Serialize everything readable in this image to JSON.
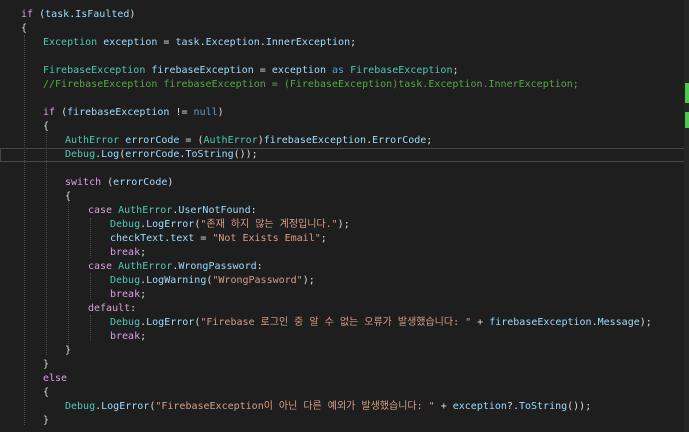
{
  "colors": {
    "background": "#1e1e1e",
    "keyword": "#569cd6",
    "control": "#d8a0df",
    "type": "#4ec9b0",
    "identifier": "#9cdcfe",
    "string": "#d69d85",
    "comment": "#57a64a",
    "text": "#dcdcdc",
    "minimap_green": "#4ec94e",
    "minimap_yellow": "#d7ba7d"
  },
  "code": {
    "l1": [
      [
        "ctl",
        "if"
      ],
      [
        "op",
        " ("
      ],
      [
        "id",
        "task"
      ],
      [
        "op",
        "."
      ],
      [
        "id",
        "IsFaulted"
      ],
      [
        "op",
        ")"
      ]
    ],
    "l2": [
      [
        "op",
        "{"
      ]
    ],
    "l3": [
      [
        "type",
        "Exception"
      ],
      [
        "op",
        " "
      ],
      [
        "id",
        "exception"
      ],
      [
        "op",
        " = "
      ],
      [
        "id",
        "task"
      ],
      [
        "op",
        "."
      ],
      [
        "id",
        "Exception"
      ],
      [
        "op",
        "."
      ],
      [
        "id",
        "InnerException"
      ],
      [
        "op",
        ";"
      ]
    ],
    "l4": [],
    "l5": [
      [
        "type",
        "FirebaseException"
      ],
      [
        "op",
        " "
      ],
      [
        "id",
        "firebaseException"
      ],
      [
        "op",
        " = "
      ],
      [
        "id",
        "exception"
      ],
      [
        "op",
        " "
      ],
      [
        "kw",
        "as"
      ],
      [
        "op",
        " "
      ],
      [
        "type",
        "FirebaseException"
      ],
      [
        "op",
        ";"
      ]
    ],
    "l6": [
      [
        "cm",
        "//FirebaseException firebaseException = (FirebaseException)task.Exception.InnerException;"
      ]
    ],
    "l7": [],
    "l8": [
      [
        "ctl",
        "if"
      ],
      [
        "op",
        " ("
      ],
      [
        "id",
        "firebaseException"
      ],
      [
        "op",
        " != "
      ],
      [
        "kw",
        "null"
      ],
      [
        "op",
        ")"
      ]
    ],
    "l9": [
      [
        "op",
        "{"
      ]
    ],
    "l10": [
      [
        "type",
        "AuthError"
      ],
      [
        "op",
        " "
      ],
      [
        "id",
        "errorCode"
      ],
      [
        "op",
        " = ("
      ],
      [
        "type",
        "AuthError"
      ],
      [
        "op",
        ")"
      ],
      [
        "id",
        "firebaseException"
      ],
      [
        "op",
        "."
      ],
      [
        "id",
        "ErrorCode"
      ],
      [
        "op",
        ";"
      ]
    ],
    "l11": [
      [
        "type",
        "Debug"
      ],
      [
        "op",
        "."
      ],
      [
        "id",
        "Log"
      ],
      [
        "op",
        "("
      ],
      [
        "id",
        "errorCode"
      ],
      [
        "op",
        "."
      ],
      [
        "id",
        "ToString"
      ],
      [
        "op",
        "());"
      ]
    ],
    "l12": [],
    "l13": [
      [
        "ctl",
        "switch"
      ],
      [
        "op",
        " ("
      ],
      [
        "id",
        "errorCode"
      ],
      [
        "op",
        ")"
      ]
    ],
    "l14": [
      [
        "op",
        "{"
      ]
    ],
    "l15": [
      [
        "ctl",
        "case"
      ],
      [
        "op",
        " "
      ],
      [
        "type",
        "AuthError"
      ],
      [
        "op",
        "."
      ],
      [
        "id",
        "UserNotFound"
      ],
      [
        "op",
        ":"
      ]
    ],
    "l16": [
      [
        "type",
        "Debug"
      ],
      [
        "op",
        "."
      ],
      [
        "id",
        "LogError"
      ],
      [
        "op",
        "("
      ],
      [
        "str",
        "\"존재 하지 않는 계정입니다.\""
      ],
      [
        "op",
        ");"
      ]
    ],
    "l17": [
      [
        "id",
        "checkText"
      ],
      [
        "op",
        "."
      ],
      [
        "id",
        "text"
      ],
      [
        "op",
        " = "
      ],
      [
        "str",
        "\"Not Exists Email\""
      ],
      [
        "op",
        ";"
      ]
    ],
    "l18": [
      [
        "ctl",
        "break"
      ],
      [
        "op",
        ";"
      ]
    ],
    "l19": [
      [
        "ctl",
        "case"
      ],
      [
        "op",
        " "
      ],
      [
        "type",
        "AuthError"
      ],
      [
        "op",
        "."
      ],
      [
        "id",
        "WrongPassword"
      ],
      [
        "op",
        ":"
      ]
    ],
    "l20": [
      [
        "type",
        "Debug"
      ],
      [
        "op",
        "."
      ],
      [
        "id",
        "LogWarning"
      ],
      [
        "op",
        "("
      ],
      [
        "str",
        "\"WrongPassword\""
      ],
      [
        "op",
        ");"
      ]
    ],
    "l21": [
      [
        "ctl",
        "break"
      ],
      [
        "op",
        ";"
      ]
    ],
    "l22": [
      [
        "ctl",
        "default"
      ],
      [
        "op",
        ":"
      ]
    ],
    "l23": [
      [
        "type",
        "Debug"
      ],
      [
        "op",
        "."
      ],
      [
        "id",
        "LogError"
      ],
      [
        "op",
        "("
      ],
      [
        "str",
        "\"Firebase 로그인 중 알 수 없는 오류가 발생했습니다: \""
      ],
      [
        "op",
        " + "
      ],
      [
        "id",
        "firebaseException"
      ],
      [
        "op",
        "."
      ],
      [
        "id",
        "Message"
      ],
      [
        "op",
        ");"
      ]
    ],
    "l24": [
      [
        "ctl",
        "break"
      ],
      [
        "op",
        ";"
      ]
    ],
    "l25": [
      [
        "op",
        "}"
      ]
    ],
    "l26": [
      [
        "op",
        "}"
      ]
    ],
    "l27": [
      [
        "ctl",
        "else"
      ]
    ],
    "l28": [
      [
        "op",
        "{"
      ]
    ],
    "l29": [
      [
        "type",
        "Debug"
      ],
      [
        "op",
        "."
      ],
      [
        "id",
        "LogError"
      ],
      [
        "op",
        "("
      ],
      [
        "str",
        "\"FirebaseException이 아닌 다른 예외가 발생했습니다: \""
      ],
      [
        "op",
        " + "
      ],
      [
        "id",
        "exception"
      ],
      [
        "op",
        "?."
      ],
      [
        "id",
        "ToString"
      ],
      [
        "op",
        "());"
      ]
    ],
    "l30": [
      [
        "op",
        "}"
      ]
    ]
  }
}
